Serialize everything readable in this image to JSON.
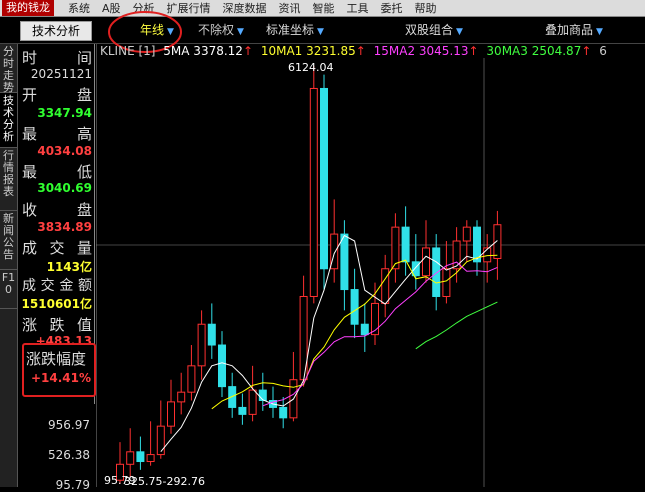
{
  "menubar": {
    "app_title": "我的钱龙",
    "items": [
      "系统",
      "A股",
      "分析",
      "扩展行情",
      "深度数据",
      "资讯",
      "智能",
      "工具",
      "委托",
      "帮助"
    ]
  },
  "toolbar": {
    "tech_tab": "技术分析",
    "period": "年线",
    "adjust": "不除权",
    "coords": "标准坐标",
    "dual": "双股组合",
    "overlay": "叠加商品"
  },
  "side_tabs": [
    "分时走势",
    "技术分析",
    "行情报表",
    "新闻公告",
    "F10"
  ],
  "info": {
    "time_label": "时间",
    "time_value": "20251121",
    "open_label": "开盘",
    "open_value": "3347.94",
    "high_label": "最高",
    "high_value": "4034.08",
    "low_label": "最低",
    "low_value": "3040.69",
    "close_label": "收盘",
    "close_value": "3834.89",
    "volume_label": "成交量",
    "volume_value": "1143亿",
    "amount_label": "成交金额",
    "amount_value": "1510601亿",
    "change_label": "涨跌值",
    "change_value": "+483.13",
    "pct_label": "涨跌幅度",
    "pct_value": "+14.41%"
  },
  "y_axis": [
    "956.97",
    "526.38",
    "95.79"
  ],
  "legend": {
    "prefix": "KLINE [1]",
    "ma5": "5MA 3378.12",
    "ma10": "10MA1 3231.85",
    "ma15": "15MA2 3045.13",
    "ma30": "30MA3 2504.87",
    "tail": "6"
  },
  "annotations": {
    "peak": "6124.04",
    "trough": "95.79",
    "bottom_range": "325.75-292.76"
  },
  "colors": {
    "up": "#ff3030",
    "down": "#30e0e8",
    "ma5": "#ffffff",
    "ma10": "#ffff00",
    "ma15": "#ff40ff",
    "ma30": "#40ff40",
    "accent_red": "#e02020"
  },
  "chart_data": {
    "type": "candlestick",
    "ylim": [
      95.79,
      6124.04
    ],
    "candles": [
      {
        "o": 150,
        "c": 380,
        "h": 700,
        "l": 95.79
      },
      {
        "o": 380,
        "c": 560,
        "h": 900,
        "l": 200
      },
      {
        "o": 560,
        "c": 420,
        "h": 780,
        "l": 300
      },
      {
        "o": 420,
        "c": 520,
        "h": 1000,
        "l": 360
      },
      {
        "o": 520,
        "c": 930,
        "h": 1300,
        "l": 460
      },
      {
        "o": 930,
        "c": 1280,
        "h": 1600,
        "l": 820
      },
      {
        "o": 1280,
        "c": 1420,
        "h": 1700,
        "l": 1100
      },
      {
        "o": 1420,
        "c": 1800,
        "h": 2100,
        "l": 1300
      },
      {
        "o": 1800,
        "c": 2400,
        "h": 2600,
        "l": 1600
      },
      {
        "o": 2400,
        "c": 2100,
        "h": 2700,
        "l": 1900
      },
      {
        "o": 2100,
        "c": 1500,
        "h": 2300,
        "l": 1350
      },
      {
        "o": 1500,
        "c": 1200,
        "h": 1700,
        "l": 1050
      },
      {
        "o": 1200,
        "c": 1100,
        "h": 1400,
        "l": 950
      },
      {
        "o": 1100,
        "c": 1450,
        "h": 1800,
        "l": 1000
      },
      {
        "o": 1450,
        "c": 1300,
        "h": 1700,
        "l": 1150
      },
      {
        "o": 1300,
        "c": 1200,
        "h": 1500,
        "l": 1050
      },
      {
        "o": 1200,
        "c": 1050,
        "h": 1350,
        "l": 900
      },
      {
        "o": 1050,
        "c": 1600,
        "h": 2000,
        "l": 1000
      },
      {
        "o": 1600,
        "c": 2800,
        "h": 3100,
        "l": 1500
      },
      {
        "o": 2800,
        "c": 5800,
        "h": 6124.04,
        "l": 2700
      },
      {
        "o": 5800,
        "c": 3200,
        "h": 6000,
        "l": 2900
      },
      {
        "o": 3200,
        "c": 3700,
        "h": 4200,
        "l": 3000
      },
      {
        "o": 3700,
        "c": 2900,
        "h": 3900,
        "l": 2600
      },
      {
        "o": 2900,
        "c": 2400,
        "h": 3200,
        "l": 2200
      },
      {
        "o": 2400,
        "c": 2250,
        "h": 2700,
        "l": 2000
      },
      {
        "o": 2250,
        "c": 2700,
        "h": 3000,
        "l": 2100
      },
      {
        "o": 2700,
        "c": 3200,
        "h": 3400,
        "l": 2500
      },
      {
        "o": 3200,
        "c": 3800,
        "h": 4000,
        "l": 3000
      },
      {
        "o": 3800,
        "c": 3300,
        "h": 4100,
        "l": 3100
      },
      {
        "o": 3300,
        "c": 3100,
        "h": 3700,
        "l": 2900
      },
      {
        "o": 3100,
        "c": 3500,
        "h": 3900,
        "l": 3000
      },
      {
        "o": 3500,
        "c": 2800,
        "h": 3700,
        "l": 2600
      },
      {
        "o": 2800,
        "c": 3200,
        "h": 3600,
        "l": 2700
      },
      {
        "o": 3200,
        "c": 3600,
        "h": 3800,
        "l": 3000
      },
      {
        "o": 3600,
        "c": 3800,
        "h": 3900,
        "l": 3300
      },
      {
        "o": 3800,
        "c": 3300,
        "h": 3900,
        "l": 3100
      },
      {
        "o": 3300,
        "c": 3500,
        "h": 3700,
        "l": 3000
      },
      {
        "o": 3347.94,
        "c": 3834.89,
        "h": 4034.08,
        "l": 3040.69
      }
    ]
  }
}
